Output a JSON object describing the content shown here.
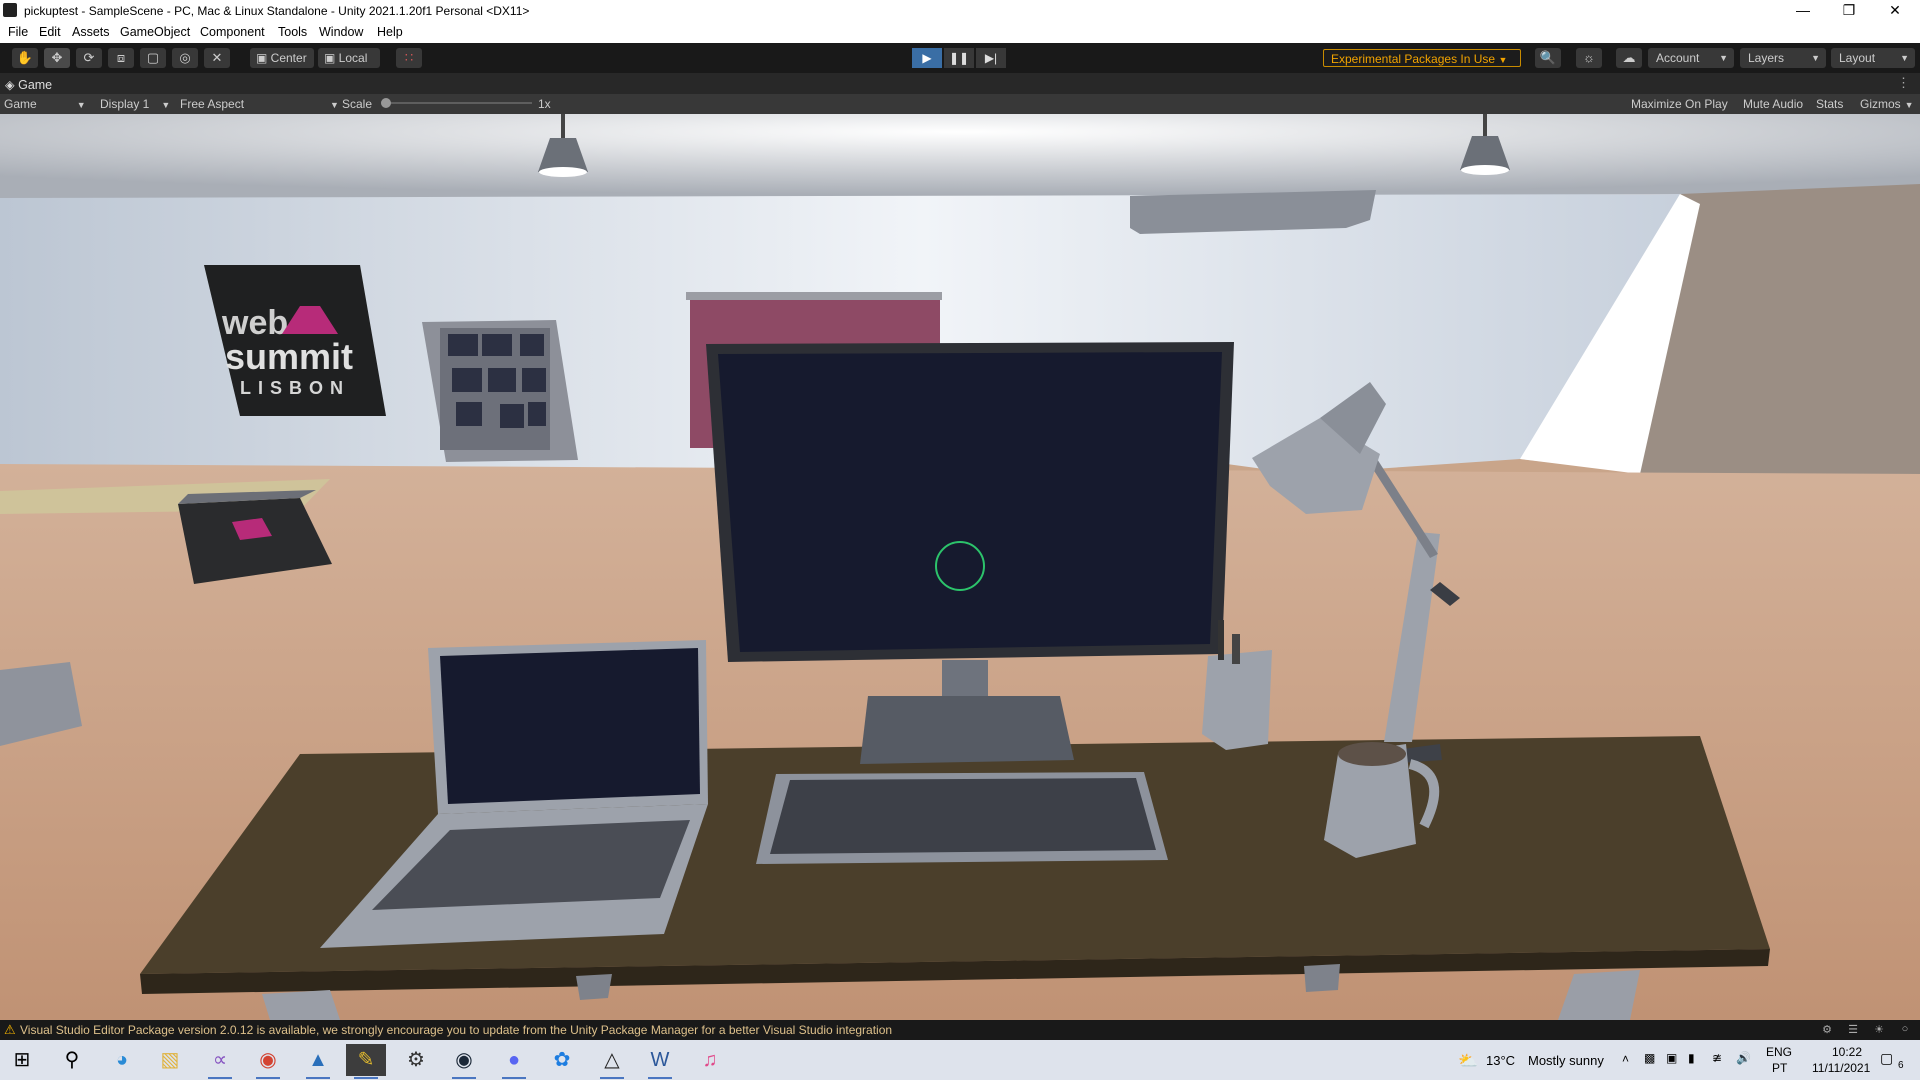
{
  "window": {
    "title": "pickuptest - SampleScene - PC, Mac & Linux Standalone - Unity 2021.1.20f1 Personal <DX11>",
    "controls": [
      "minimize-icon",
      "restore-icon",
      "close-icon"
    ]
  },
  "menu": [
    "File",
    "Edit",
    "Assets",
    "GameObject",
    "Component",
    "Tools",
    "Window",
    "Help"
  ],
  "toolbar": {
    "tools": [
      "hand-icon",
      "move-icon",
      "rotate-icon",
      "scale-icon",
      "rect-icon",
      "transform-icon",
      "custom-tool-icon"
    ],
    "pivot_label": "Center",
    "space_label": "Local",
    "snap_icon": "grid-snap-icon",
    "play_icons": [
      "play-icon",
      "pause-icon",
      "step-icon"
    ],
    "play_active": true,
    "experimental_label": "Experimental Packages In Use",
    "account_label": "Account",
    "layers_label": "Layers",
    "layout_label": "Layout",
    "accent_color": "#f1a300"
  },
  "game_tab": {
    "label": "Game"
  },
  "game_view_bar": {
    "mode": "Game",
    "display": "Display 1",
    "aspect": "Free Aspect",
    "scale_label": "Scale",
    "scale_value": "1x",
    "toggles": [
      "Maximize On Play",
      "Mute Audio",
      "Stats",
      "Gizmos"
    ]
  },
  "scene": {
    "poster_text": [
      "web",
      "summit",
      "LISBON"
    ],
    "crosshair_color": "#2cc36b"
  },
  "status": {
    "message": "Visual Studio Editor Package version 2.0.12 is available, we strongly encourage you to update from the Unity Package Manager for a better Visual Studio integration"
  },
  "taskbar": {
    "apps": [
      "windows-start-icon",
      "search-icon",
      "edge-icon",
      "file-explorer-icon",
      "visual-studio-icon",
      "chrome-icon",
      "photos-icon",
      "sticky-app-icon",
      "settings-icon",
      "steam-icon",
      "discord-icon",
      "bluetooth-app-icon",
      "unity-icon",
      "word-icon",
      "itunes-icon"
    ],
    "weather_temp": "13°C",
    "weather_desc": "Mostly sunny",
    "lang": "ENG",
    "lang_region": "PT",
    "time": "10:22",
    "date": "11/11/2021",
    "notifications": "6"
  }
}
